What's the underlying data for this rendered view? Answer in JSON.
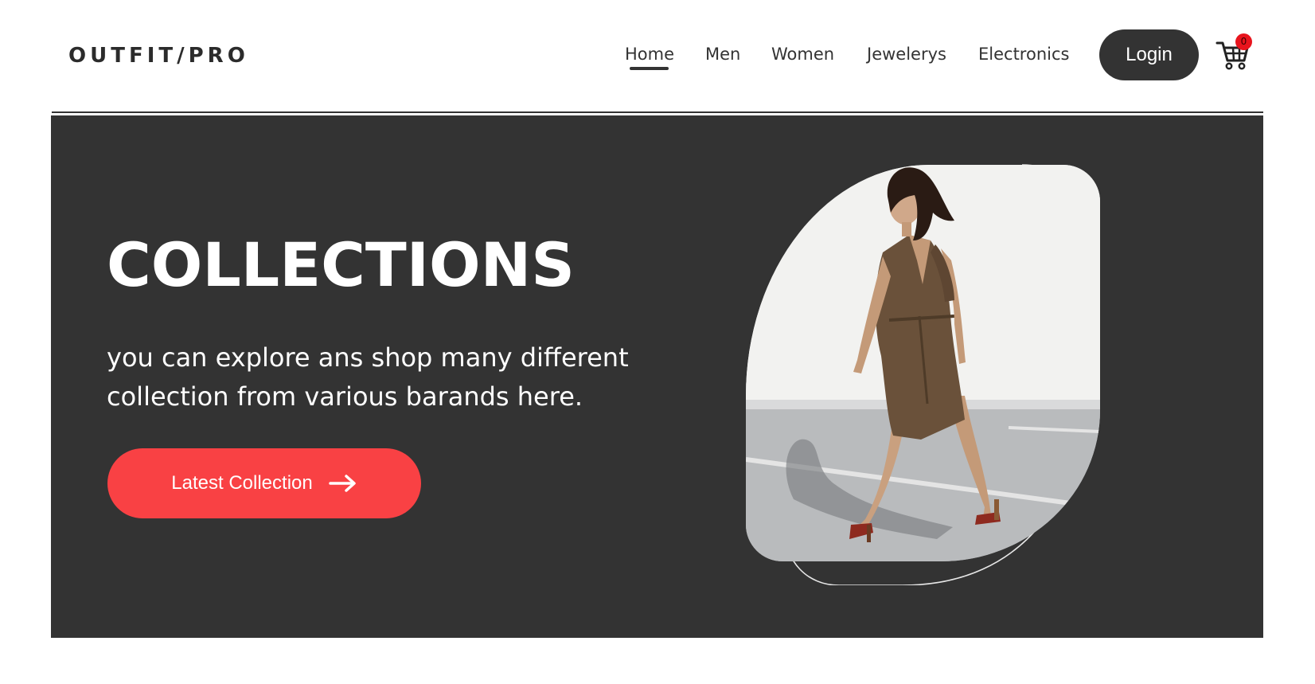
{
  "header": {
    "logo": "OUTFIT/PRO",
    "nav": [
      {
        "label": "Home",
        "active": true
      },
      {
        "label": "Men"
      },
      {
        "label": "Women"
      },
      {
        "label": "Jewelerys"
      },
      {
        "label": "Electronics"
      }
    ],
    "login_label": "Login",
    "cart": {
      "icon": "cart-icon",
      "count": "0",
      "badge_color": "#e8141d"
    }
  },
  "hero": {
    "title": "COLLECTIONS",
    "description": "you can explore ans shop many different collection from various barands here.",
    "cta_label": "Latest Collection",
    "cta_icon": "arrow-right-icon",
    "background_color": "#333333",
    "cta_color": "#f94144",
    "image_alt": "woman walking in brown wrap dress"
  }
}
